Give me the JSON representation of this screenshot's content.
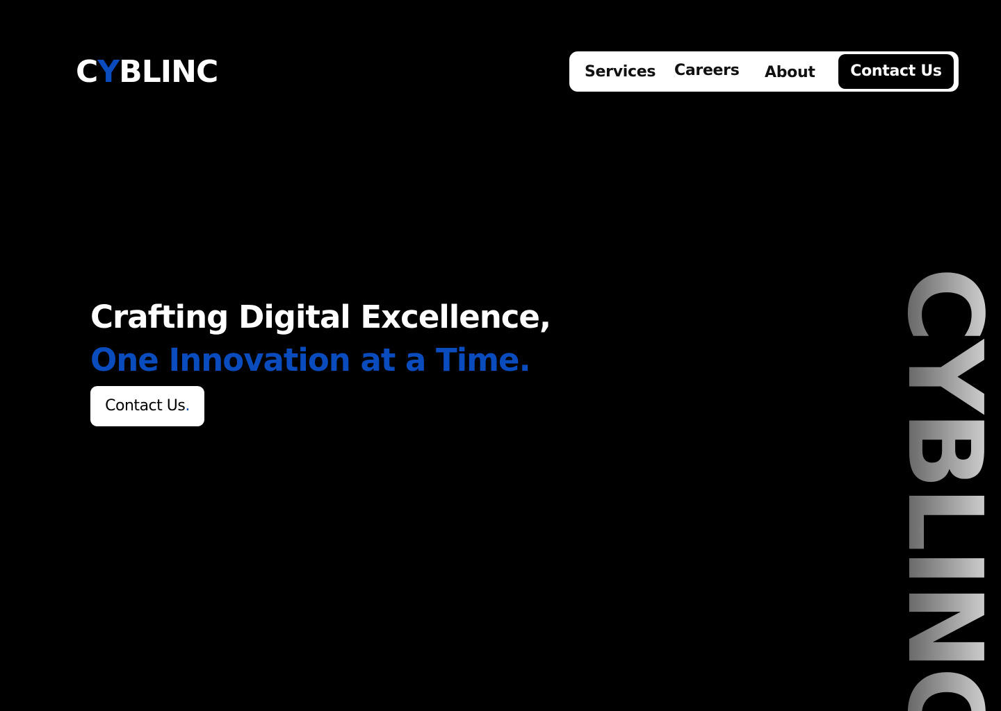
{
  "brand": {
    "logo_prefix": "C",
    "logo_accent": "Y",
    "logo_suffix": "BLINC",
    "watermark_text": "CYBLINC"
  },
  "nav": {
    "items": [
      {
        "label": "Services"
      },
      {
        "label": "Careers"
      },
      {
        "label": "About"
      }
    ],
    "contact_label": "Contact Us"
  },
  "hero": {
    "headline_line1": "Crafting Digital Excellence,",
    "headline_line2": "One Innovation at a Time.",
    "cta_label": "Contact Us",
    "cta_dot": "."
  },
  "colors": {
    "background": "#000000",
    "accent_blue": "#0a4bbd",
    "text_white": "#ffffff",
    "watermark_top": "#e6e6e6",
    "watermark_bottom": "#4a4a4a"
  }
}
